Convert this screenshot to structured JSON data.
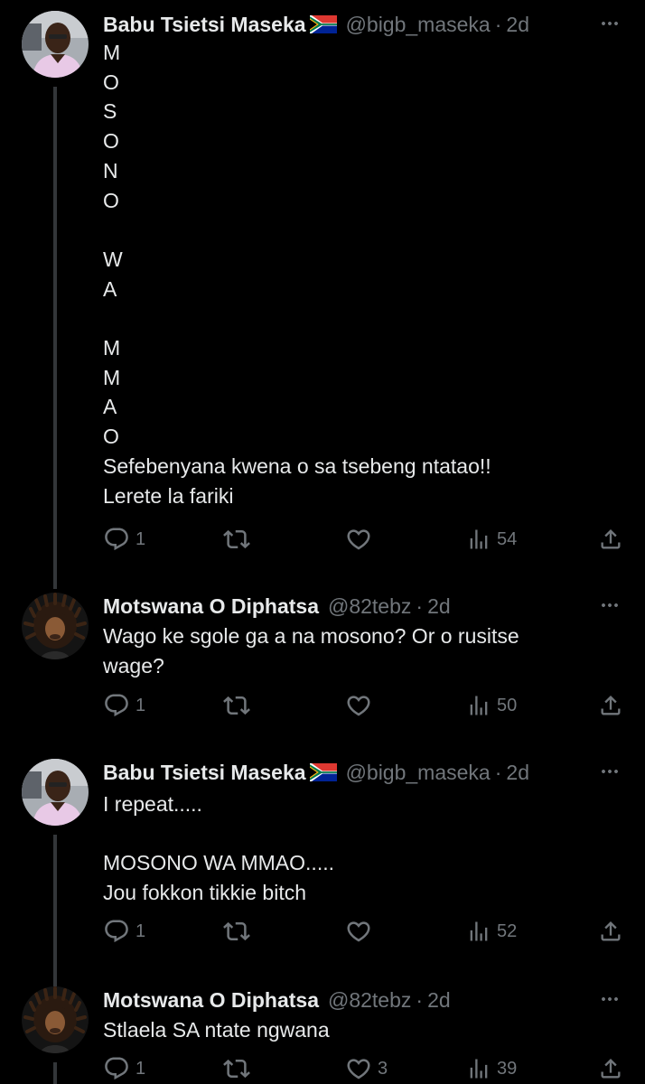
{
  "colors": {
    "background": "#000000",
    "text": "#e7e9ea",
    "muted": "#71767b",
    "thread_line": "#333639"
  },
  "tweets": [
    {
      "name": "Babu Tsietsi Maseka",
      "flag": "south-africa-flag",
      "handle": "@bigb_maseka",
      "dot": "·",
      "time": "2d",
      "text": "M\nO\nS\nO\nN\nO\n\nW\nA\n\nM\nM\nA\nO\nSefebenyana kwena o sa tsebeng ntatao!!\nLerete la fariki",
      "replies": "1",
      "reposts": "",
      "likes": "",
      "views": "54"
    },
    {
      "name": "Motswana O Diphatsa",
      "flag": "",
      "handle": "@82tebz",
      "dot": "·",
      "time": "2d",
      "text": "Wago ke sgole ga a na mosono? Or o rusitse\nwage?",
      "replies": "1",
      "reposts": "",
      "likes": "",
      "views": "50"
    },
    {
      "name": "Babu Tsietsi Maseka",
      "flag": "south-africa-flag",
      "handle": "@bigb_maseka",
      "dot": "·",
      "time": "2d",
      "text": "I repeat.....\n\nMOSONO WA MMAO.....\nJou fokkon tikkie bitch",
      "replies": "1",
      "reposts": "",
      "likes": "",
      "views": "52"
    },
    {
      "name": "Motswana O Diphatsa",
      "flag": "",
      "handle": "@82tebz",
      "dot": "·",
      "time": "2d",
      "text": "Stlaela SA ntate ngwana",
      "replies": "1",
      "reposts": "",
      "likes": "3",
      "views": "39"
    }
  ]
}
